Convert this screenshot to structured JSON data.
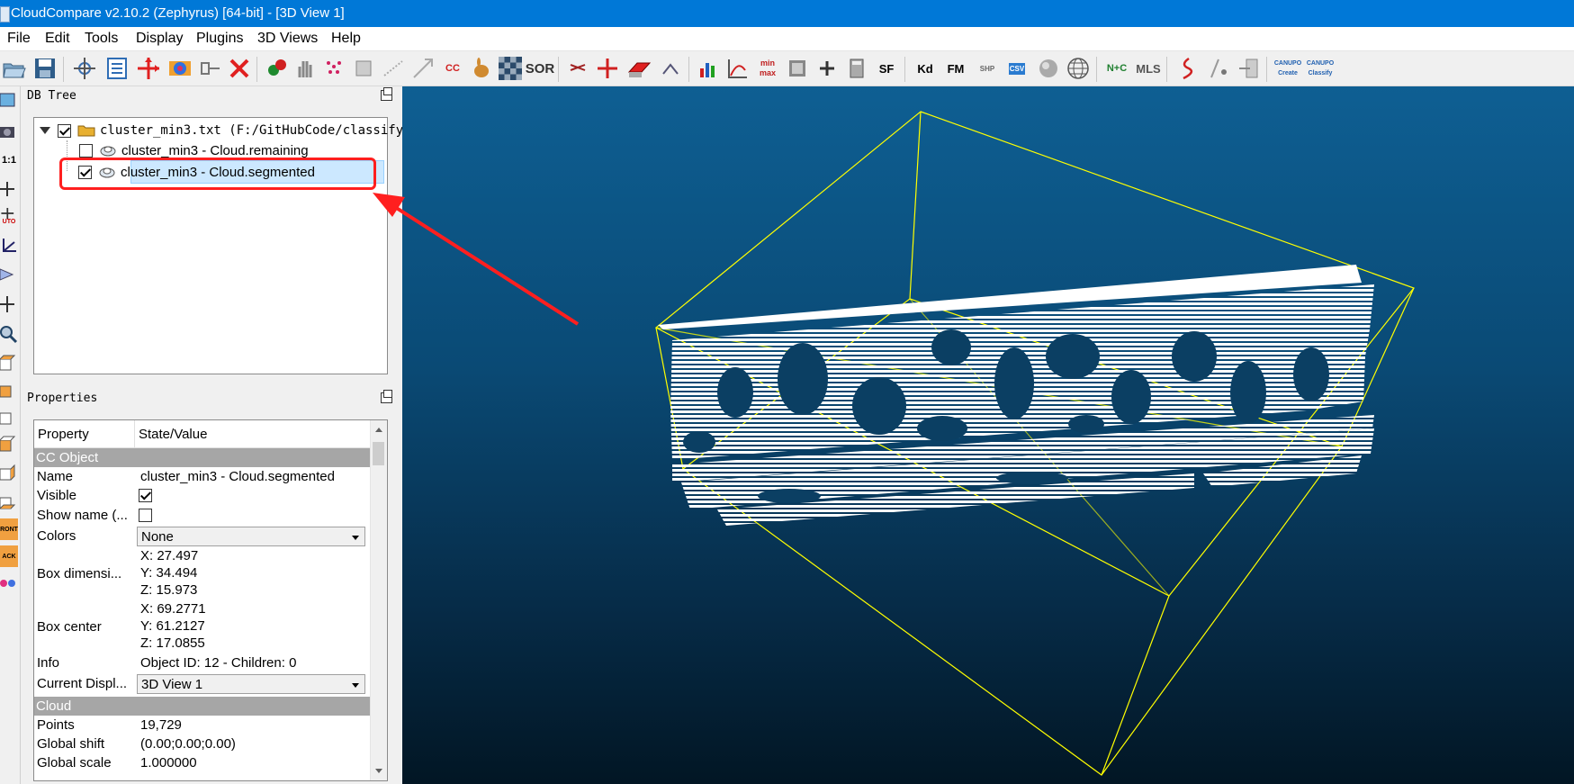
{
  "window": {
    "title": "CloudCompare v2.10.2 (Zephyrus) [64-bit] - [3D View 1]"
  },
  "menu": [
    {
      "label": "File"
    },
    {
      "label": "Edit"
    },
    {
      "label": "Tools"
    },
    {
      "label": "Display"
    },
    {
      "label": "Plugins"
    },
    {
      "label": "3D Views"
    },
    {
      "label": "Help"
    }
  ],
  "toolbar": {
    "sor_label": "SOR",
    "cc_label": "CC",
    "sf_label": "SF",
    "kd_label": "Kd",
    "fm_label": "FM",
    "shp_label": "SHP",
    "csv_label": "CSV",
    "nc_label": "N+C",
    "mls_label": "MLS",
    "minmax_label": "min max",
    "canupo_create_label": "CANUPO Create",
    "canupo_classify_label": "CANUPO Classify"
  },
  "left_toolbar": {
    "ratio_label": "1:1",
    "front_label": "RONT",
    "back_label": "ACK",
    "auto_label": "UTO"
  },
  "db_tree": {
    "panel_title": "DB Tree",
    "root": {
      "label": "cluster_min3.txt (F:/GitHubCode/classify",
      "checked": true
    },
    "children": [
      {
        "label": "cluster_min3 - Cloud.remaining",
        "checked": false
      },
      {
        "label": "cluster_min3 - Cloud.segmented",
        "checked": true,
        "selected": true
      }
    ]
  },
  "properties": {
    "panel_title": "Properties",
    "col_property": "Property",
    "col_value": "State/Value",
    "sections": {
      "cc_object": "CC Object",
      "cloud": "Cloud"
    },
    "name_key": "Name",
    "name_value": "cluster_min3 - Cloud.segmented",
    "visible_key": "Visible",
    "show_name_key": "Show name (...",
    "colors_key": "Colors",
    "colors_value": "None",
    "box_dim_key": "Box dimensi...",
    "box_dim_x": "X: 27.497",
    "box_dim_y": "Y: 34.494",
    "box_dim_z": "Z: 15.973",
    "box_center_key": "Box center",
    "box_center_x": "X: 69.2771",
    "box_center_y": "Y: 61.2127",
    "box_center_z": "Z: 17.0855",
    "info_key": "Info",
    "info_value": "Object ID: 12 - Children: 0",
    "current_display_key": "Current Displ...",
    "current_display_value": "3D View 1",
    "points_key": "Points",
    "points_value": "19,729",
    "global_shift_key": "Global shift",
    "global_shift_value": "(0.00;0.00;0.00)",
    "global_scale_key": "Global scale",
    "global_scale_value": "1.000000"
  },
  "colors": {
    "title_bar": "#0078d7",
    "annotation": "#ff1f1f",
    "bounding_box": "#ffff00",
    "points": "#ffffff",
    "selection": "#cce8ff"
  }
}
